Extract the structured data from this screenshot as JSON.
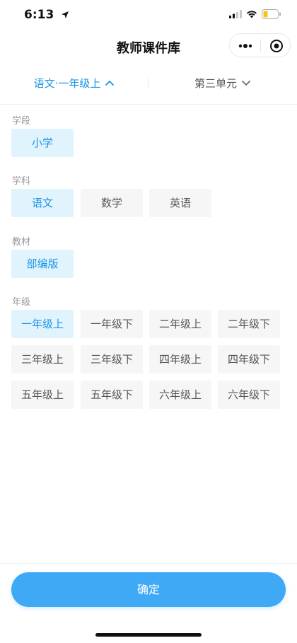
{
  "status_bar": {
    "time": "6:13"
  },
  "nav": {
    "title": "教师课件库"
  },
  "filter": {
    "left_label": "语文·一年级上",
    "right_label": "第三单元"
  },
  "sections": {
    "stage": {
      "label": "学段",
      "options": [
        "小学"
      ],
      "selected": "小学"
    },
    "subject": {
      "label": "学科",
      "options": [
        "语文",
        "数学",
        "英语"
      ],
      "selected": "语文"
    },
    "textbook": {
      "label": "教材",
      "options": [
        "部编版"
      ],
      "selected": "部编版"
    },
    "grade": {
      "label": "年级",
      "options": [
        "一年级上",
        "一年级下",
        "二年级上",
        "二年级下",
        "三年级上",
        "三年级下",
        "四年级上",
        "四年级下",
        "五年级上",
        "五年级下",
        "六年级上",
        "六年级下"
      ],
      "selected": "一年级上"
    }
  },
  "confirm": {
    "label": "确定"
  },
  "colors": {
    "accent": "#1a95e6",
    "selected_bg": "#e1f3fd",
    "button": "#40a9f6",
    "chip_bg": "#f6f6f6"
  }
}
